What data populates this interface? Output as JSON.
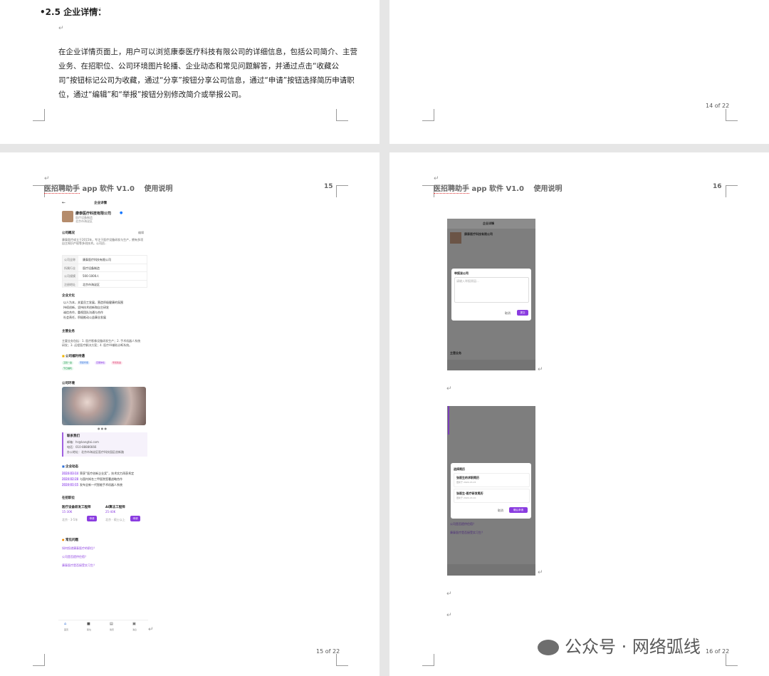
{
  "page1": {
    "heading": "•2.5 企业详情：",
    "body": "在企业详情页面上，用户可以浏览康泰医疗科技有限公司的详细信息，包括公司简介、主营业务、在招职位、公司环境图片轮播、企业动态和常见问题解答，并通过点击“收藏公司”按钮标记公司为收藏，通过“分享”按钮分享公司信息，通过“申请”按钮选择简历申请职位，通过“编辑”和“举报”按钮分别修改简介或举报公司。"
  },
  "page2": {
    "page_number": "14 of 22"
  },
  "page3": {
    "header_app": "医招聘助手",
    "header_rest": " app 软件 V1.0　 使用说明",
    "header_num": "15",
    "footer_num": "15 of 22",
    "phone": {
      "back": "←",
      "title": "企业详情",
      "company": "康泰医疗科技有限公司",
      "industry": "医疗设备制造",
      "location": "北京市海淀区",
      "intro_title": "公司概况",
      "edit": "编辑",
      "intro_text": "康泰医疗成立于2015年，专注于医疗设备研发与生产，拥有多项自主知识产权等多项技术。公司员..",
      "table": [
        {
          "k": "公司全称",
          "v": "康泰医疗科技有限公司"
        },
        {
          "k": "所属行业",
          "v": "医疗设备制造"
        },
        {
          "k": "公司规模",
          "v": "500-1000人"
        },
        {
          "k": "注册地址",
          "v": "北京市海淀区"
        }
      ],
      "culture_title": "企业文化",
      "culture": [
        "以人为本，关爱员工发展，营造积极健康的氛围",
        "持续创新，坚持技术创新和自主研发",
        "诚信合作，重视团队沟通与合作",
        "社会责任，积极推动公益事业发展"
      ],
      "business_title": "主营业务",
      "business_text": "主要业务包括：1. 医疗影像设备研发生产；2. 手术机器人系统研发；3. 远程医疗解决方案；4. 医疗AI辅助诊断系统。",
      "welfare_title": "公司福利待遇",
      "welfare": [
        "五险一金",
        "带薪年假",
        "定期体检",
        "年终奖金",
        "节日福利"
      ],
      "env_title": "公司环境",
      "contact_title": "联系我们",
      "contact": [
        "邮箱：hr@kangtai.com",
        "电话：010-88886666",
        "办公地址：北京市海淀区医疗科技园区创新路"
      ],
      "news_title": "企业动态",
      "news": [
        {
          "d": "2024-03-14",
          "t": "荣获“医疗创新企业奖”，技术实力再获肯定"
        },
        {
          "d": "2024-02-28",
          "t": "与国内知名三甲医院签署战略合作"
        },
        {
          "d": "2024-01-15",
          "t": "发布全新一代智能手术机器人系统"
        }
      ],
      "jobs_title": "在招职位",
      "jobs": [
        {
          "name": "医疗设备研发工程师",
          "salary": "15-30K",
          "meta": "北京 · 3-5年",
          "btn": "申请"
        },
        {
          "name": "AI算法工程师",
          "salary": "25-40K",
          "meta": "北京 · 硕士以上",
          "btn": "申请"
        }
      ],
      "faq_title": "常见问题",
      "faq": [
        "如何投递康泰医疗的职位？",
        "公司是否提供住宿？",
        "康泰医疗是否接受实习生？"
      ],
      "nav": [
        "首页",
        "职位",
        "简历",
        "消息"
      ]
    }
  },
  "page4": {
    "header_app": "医招聘助手",
    "header_rest": " app 软件 V1.0　 使用说明",
    "header_num": "16",
    "footer_num": "16 of 22",
    "shot1": {
      "title": "企业详情",
      "company": "康泰医疗科技有限公司",
      "dialog_title": "举报该公司",
      "placeholder": "请输入举报原因...",
      "cancel": "取消",
      "submit": "提交",
      "section": "主营业务"
    },
    "shot2": {
      "dialog_title": "选择简历",
      "resumes": [
        {
          "name": "张医生的求职简历",
          "date": "更新于 2024-03-15"
        },
        {
          "name": "张医生-医疗研发简历",
          "date": "更新于 2024-03-10"
        }
      ],
      "cancel": "取消",
      "confirm": "确认申请",
      "faq": [
        "公司是否提供住宿？",
        "康泰医疗是否接受实习生？"
      ]
    }
  },
  "watermark": "公众号 · 网络弧线"
}
